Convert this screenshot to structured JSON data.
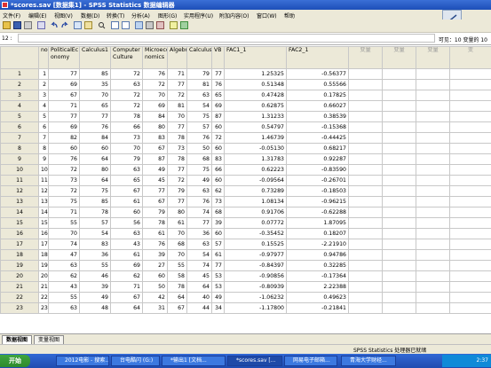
{
  "window": {
    "title": "*scores.sav [数据集1] - SPSS Statistics 数据编辑器"
  },
  "menu": [
    "文件(F)",
    "编辑(E)",
    "视图(V)",
    "数据(D)",
    "转换(T)",
    "分析(A)",
    "图形(G)",
    "实用程序(U)",
    "附加内容(O)",
    "窗口(W)",
    "帮助"
  ],
  "editor": {
    "cell_ref": "12 :",
    "visible_vars": "可见：10 变量的 10"
  },
  "columns": [
    "no",
    "PoliticalEconomy",
    "Calculus1",
    "ComputerCulture",
    "Microeconomics",
    "Algebra",
    "Calculus2",
    "VB",
    "FAC1_1",
    "FAC2_1",
    "变量",
    "变量",
    "变量",
    "变"
  ],
  "column_labels": [
    "no",
    "PoliticalEc onomy",
    "Calculus1",
    "Computer Culture",
    "Microeco nomics",
    "Algebra",
    "Calculus2",
    "VB",
    "FAC1_1",
    "FAC2_1",
    "变量",
    "变量",
    "变量",
    "变"
  ],
  "rows": [
    [
      "1",
      "77",
      "85",
      "72",
      "76",
      "71",
      "79",
      "77",
      "1.25325",
      "-0.56377"
    ],
    [
      "2",
      "69",
      "35",
      "63",
      "72",
      "77",
      "81",
      "76",
      "0.51348",
      "0.55566"
    ],
    [
      "3",
      "67",
      "70",
      "72",
      "70",
      "72",
      "63",
      "65",
      "0.47428",
      "0.17825"
    ],
    [
      "4",
      "71",
      "65",
      "72",
      "69",
      "81",
      "54",
      "69",
      "0.62875",
      "0.66027"
    ],
    [
      "5",
      "77",
      "77",
      "78",
      "84",
      "70",
      "75",
      "87",
      "1.31233",
      "0.38539"
    ],
    [
      "6",
      "69",
      "76",
      "66",
      "80",
      "77",
      "57",
      "60",
      "0.54797",
      "-0.15368"
    ],
    [
      "7",
      "82",
      "84",
      "73",
      "83",
      "78",
      "76",
      "72",
      "1.46739",
      "-0.44425"
    ],
    [
      "8",
      "60",
      "60",
      "70",
      "67",
      "73",
      "50",
      "60",
      "-0.05130",
      "0.68217"
    ],
    [
      "9",
      "76",
      "64",
      "79",
      "87",
      "78",
      "68",
      "83",
      "1.31783",
      "0.92287"
    ],
    [
      "10",
      "72",
      "80",
      "63",
      "49",
      "77",
      "75",
      "66",
      "0.62223",
      "-0.83590"
    ],
    [
      "11",
      "73",
      "64",
      "65",
      "45",
      "72",
      "49",
      "60",
      "-0.09564",
      "-0.26701"
    ],
    [
      "12",
      "72",
      "75",
      "67",
      "77",
      "79",
      "63",
      "62",
      "0.73289",
      "-0.18503"
    ],
    [
      "13",
      "75",
      "85",
      "61",
      "67",
      "77",
      "76",
      "73",
      "1.08134",
      "-0.96215"
    ],
    [
      "14",
      "71",
      "78",
      "60",
      "79",
      "80",
      "74",
      "68",
      "0.91706",
      "-0.62288"
    ],
    [
      "15",
      "55",
      "57",
      "56",
      "78",
      "61",
      "77",
      "39",
      "0.07772",
      "1.87095"
    ],
    [
      "16",
      "70",
      "54",
      "63",
      "61",
      "70",
      "36",
      "60",
      "-0.35452",
      "0.18207"
    ],
    [
      "17",
      "74",
      "83",
      "43",
      "76",
      "68",
      "63",
      "57",
      "0.15525",
      "-2.21910"
    ],
    [
      "18",
      "47",
      "36",
      "61",
      "39",
      "70",
      "54",
      "61",
      "-0.97977",
      "0.94786"
    ],
    [
      "19",
      "63",
      "55",
      "69",
      "27",
      "55",
      "74",
      "77",
      "-0.84397",
      "0.32285"
    ],
    [
      "20",
      "62",
      "46",
      "62",
      "60",
      "58",
      "45",
      "53",
      "-0.90856",
      "-0.17364"
    ],
    [
      "21",
      "43",
      "39",
      "71",
      "50",
      "78",
      "64",
      "53",
      "-0.80939",
      "2.22388"
    ],
    [
      "22",
      "55",
      "49",
      "67",
      "42",
      "64",
      "40",
      "49",
      "-1.06232",
      "0.49623"
    ],
    [
      "23",
      "63",
      "48",
      "64",
      "31",
      "67",
      "44",
      "34",
      "-1.17800",
      "-0.21841"
    ]
  ],
  "tabs": {
    "data_view": "数据视图",
    "variable_view": "变量视图"
  },
  "status": "SPSS Statistics  处理器已就绪",
  "taskbar": {
    "start": "开始",
    "items": [
      "2012电影 - 搜索...",
      "台电酷闪 (G:)",
      "*输出1 [文档...",
      "*scores.sav [...",
      "网易电子邮箱...",
      "青海大学财经..."
    ],
    "clock": "2:37"
  },
  "icons": [
    "open-icon",
    "save-icon",
    "print-icon",
    "undo-icon",
    "redo-icon",
    "goto-icon",
    "find-icon",
    "insert-case-icon",
    "insert-variable-icon",
    "split-icon",
    "weight-icon",
    "select-icon",
    "value-labels-icon",
    "use-sets-icon"
  ]
}
